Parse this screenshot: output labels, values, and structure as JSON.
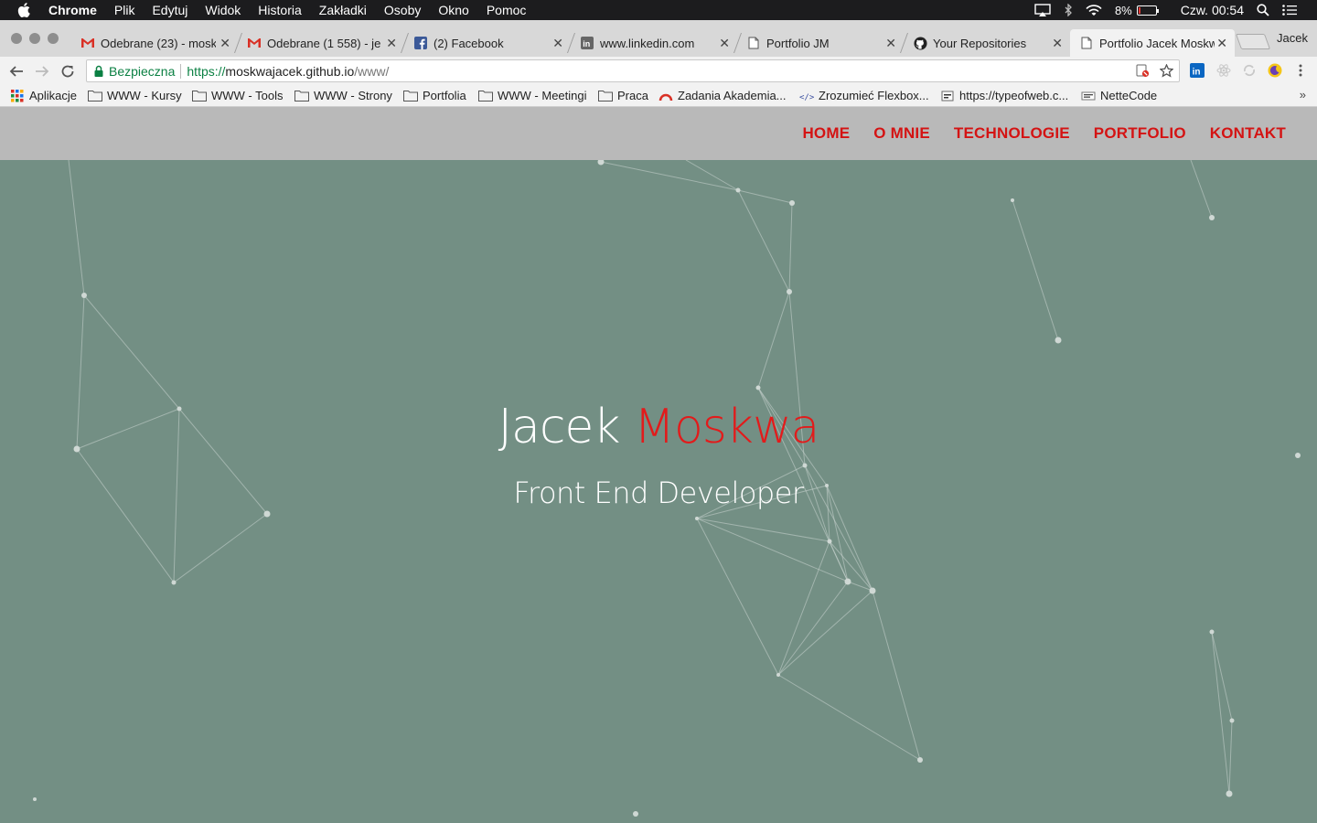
{
  "menubar": {
    "app": "Chrome",
    "items": [
      "Plik",
      "Edytuj",
      "Widok",
      "Historia",
      "Zakładki",
      "Osoby",
      "Okno",
      "Pomoc"
    ],
    "battery": "8%",
    "battery_level": 0.08,
    "clock": "Czw. 00:54",
    "icons": [
      "apple-icon",
      "airplay-icon",
      "bluetooth-icon",
      "wifi-icon",
      "battery-icon",
      "search-icon",
      "notification-center-icon"
    ]
  },
  "tabs": [
    {
      "title": "Odebrane (23) - mosk",
      "icon": "gmail-icon"
    },
    {
      "title": "Odebrane (1 558) - je",
      "icon": "gmail-icon"
    },
    {
      "title": "(2) Facebook",
      "icon": "facebook-icon"
    },
    {
      "title": "www.linkedin.com",
      "icon": "linkedin-icon"
    },
    {
      "title": "Portfolio JM",
      "icon": "page-icon"
    },
    {
      "title": "Your Repositories",
      "icon": "github-icon"
    },
    {
      "title": "Portfolio Jacek Moskw",
      "icon": "page-icon",
      "active": true
    }
  ],
  "profile_name": "Jacek",
  "addressbar": {
    "secure_label": "Bezpieczna",
    "scheme": "https://",
    "host": "moskwajacek.github.io",
    "path": "/www/"
  },
  "bookmarks": [
    {
      "label": "Aplikacje",
      "icon": "apps-grid-icon"
    },
    {
      "label": "WWW - Kursy",
      "icon": "folder-icon"
    },
    {
      "label": "WWW - Tools",
      "icon": "folder-icon"
    },
    {
      "label": "WWW - Strony",
      "icon": "folder-icon"
    },
    {
      "label": "Portfolia",
      "icon": "folder-icon"
    },
    {
      "label": "WWW - Meetingi",
      "icon": "folder-icon"
    },
    {
      "label": "Praca",
      "icon": "folder-icon"
    },
    {
      "label": "Zadania Akademia...",
      "icon": "akademia-icon"
    },
    {
      "label": "Zrozumieć Flexbox...",
      "icon": "flexbox-icon"
    },
    {
      "label": "https://typeofweb.c...",
      "icon": "typeofweb-icon"
    },
    {
      "label": "NetteCode",
      "icon": "nettecode-icon"
    }
  ],
  "bookmarks_more": "»",
  "site": {
    "nav": [
      "HOME",
      "O MNIE",
      "TECHNOLOGIE",
      "PORTFOLIO",
      "KONTAKT"
    ],
    "accent_color": "#d41313",
    "hero_bg": "#738f84",
    "first_name": "Jacek",
    "last_name": "Moskwa",
    "subtitle": "Front End Developer"
  }
}
